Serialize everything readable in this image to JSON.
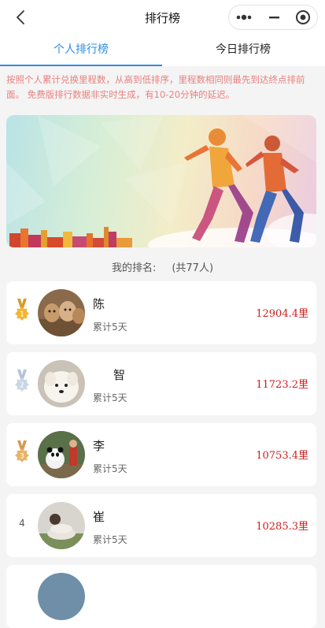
{
  "nav": {
    "title": "排行榜",
    "back_icon": "chevron-left-icon",
    "capsule": [
      "more-dots-icon",
      "minimize-icon",
      "close-target-icon"
    ]
  },
  "tabs": [
    {
      "label": "个人排行榜",
      "active": true
    },
    {
      "label": "今日排行榜",
      "active": false
    }
  ],
  "notice": "按照个人累计兑换里程数，从高到低排序，里程数相同则最先到达终点排前面。 免费版排行数据非实时生成，有10-20分钟的延迟。",
  "my_rank": {
    "label": "我的排名:",
    "total": "(共77人)"
  },
  "colors": {
    "accent": "#2f8de4",
    "notice": "#e8817f",
    "distance": "#cf1f1f",
    "gold": "#f2b632",
    "silver": "#c9d6e6",
    "bronze": "#e8b46a"
  },
  "rankings": [
    {
      "rank": "1",
      "medal": "gold",
      "name": "陈",
      "days": "累计5天",
      "distance": "12904.4里",
      "avatar": "dogs-photo"
    },
    {
      "rank": "2",
      "medal": "silver",
      "name": "智",
      "days": "累计5天",
      "distance": "11723.2里",
      "avatar": "white-dog-photo"
    },
    {
      "rank": "3",
      "medal": "bronze",
      "name": "李",
      "days": "累计5天",
      "distance": "10753.4里",
      "avatar": "panda-photo"
    },
    {
      "rank": "4",
      "medal": "",
      "name": "崔",
      "days": "累计5天",
      "distance": "10285.3里",
      "avatar": "person-photo"
    }
  ]
}
